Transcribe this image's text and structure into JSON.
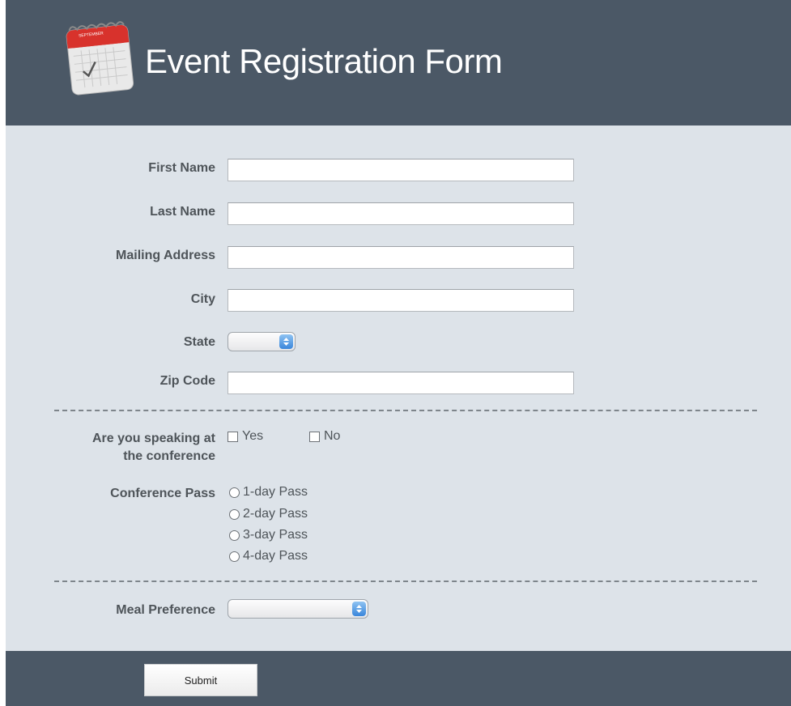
{
  "header": {
    "title": "Event Registration Form",
    "calendar_month": "SEPTEMBER"
  },
  "form": {
    "first_name_label": "First Name",
    "last_name_label": "Last Name",
    "address_label": "Mailing Address",
    "city_label": "City",
    "state_label": "State",
    "zip_label": "Zip Code",
    "speaking_label_line1": "Are you speaking at",
    "speaking_label_line2": "the conference",
    "speaking_yes": "Yes",
    "speaking_no": "No",
    "pass_label": "Conference Pass",
    "pass_options": [
      "1-day Pass",
      "2-day Pass",
      "3-day Pass",
      "4-day Pass"
    ],
    "meal_label": "Meal Preference"
  },
  "footer": {
    "submit_label": "Submit"
  },
  "colors": {
    "header": "#4b5866",
    "form_bg": "#dde3e9",
    "label": "#4e5459",
    "select_arrow": "#3a86db"
  }
}
